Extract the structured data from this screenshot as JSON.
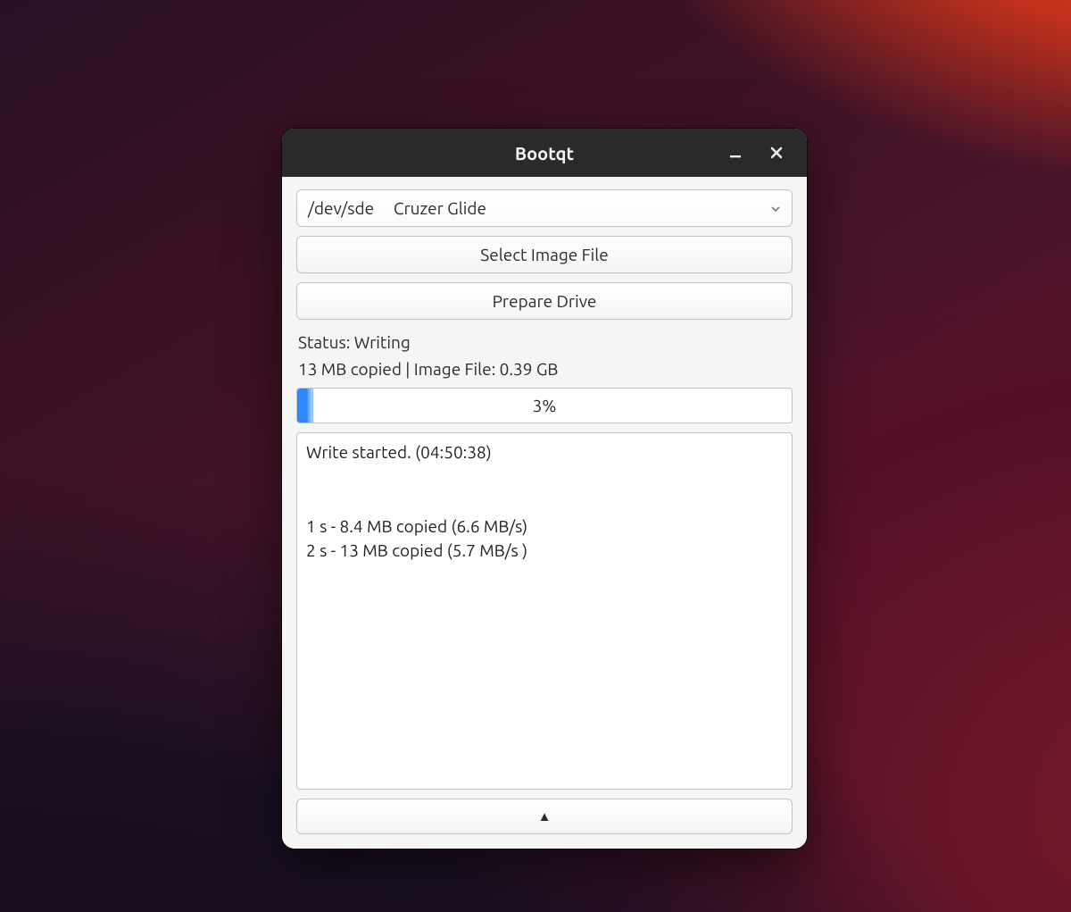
{
  "window": {
    "title": "Bootqt"
  },
  "drive_selector": {
    "path": "/dev/sde",
    "label": "Cruzer Glide"
  },
  "buttons": {
    "select_image": "Select Image File",
    "prepare_drive": "Prepare Drive",
    "expander_glyph": "▲"
  },
  "status": {
    "line": "Status: Writing",
    "copied_line": "13 MB copied | Image File: 0.39 GB",
    "percent_label": "3%",
    "percent_value": 3
  },
  "log": {
    "text": "Write started. (04:50:38)\n\n\n1 s - 8.4 MB copied (6.6 MB/s)\n2 s - 13 MB copied (5.7 MB/s )"
  }
}
